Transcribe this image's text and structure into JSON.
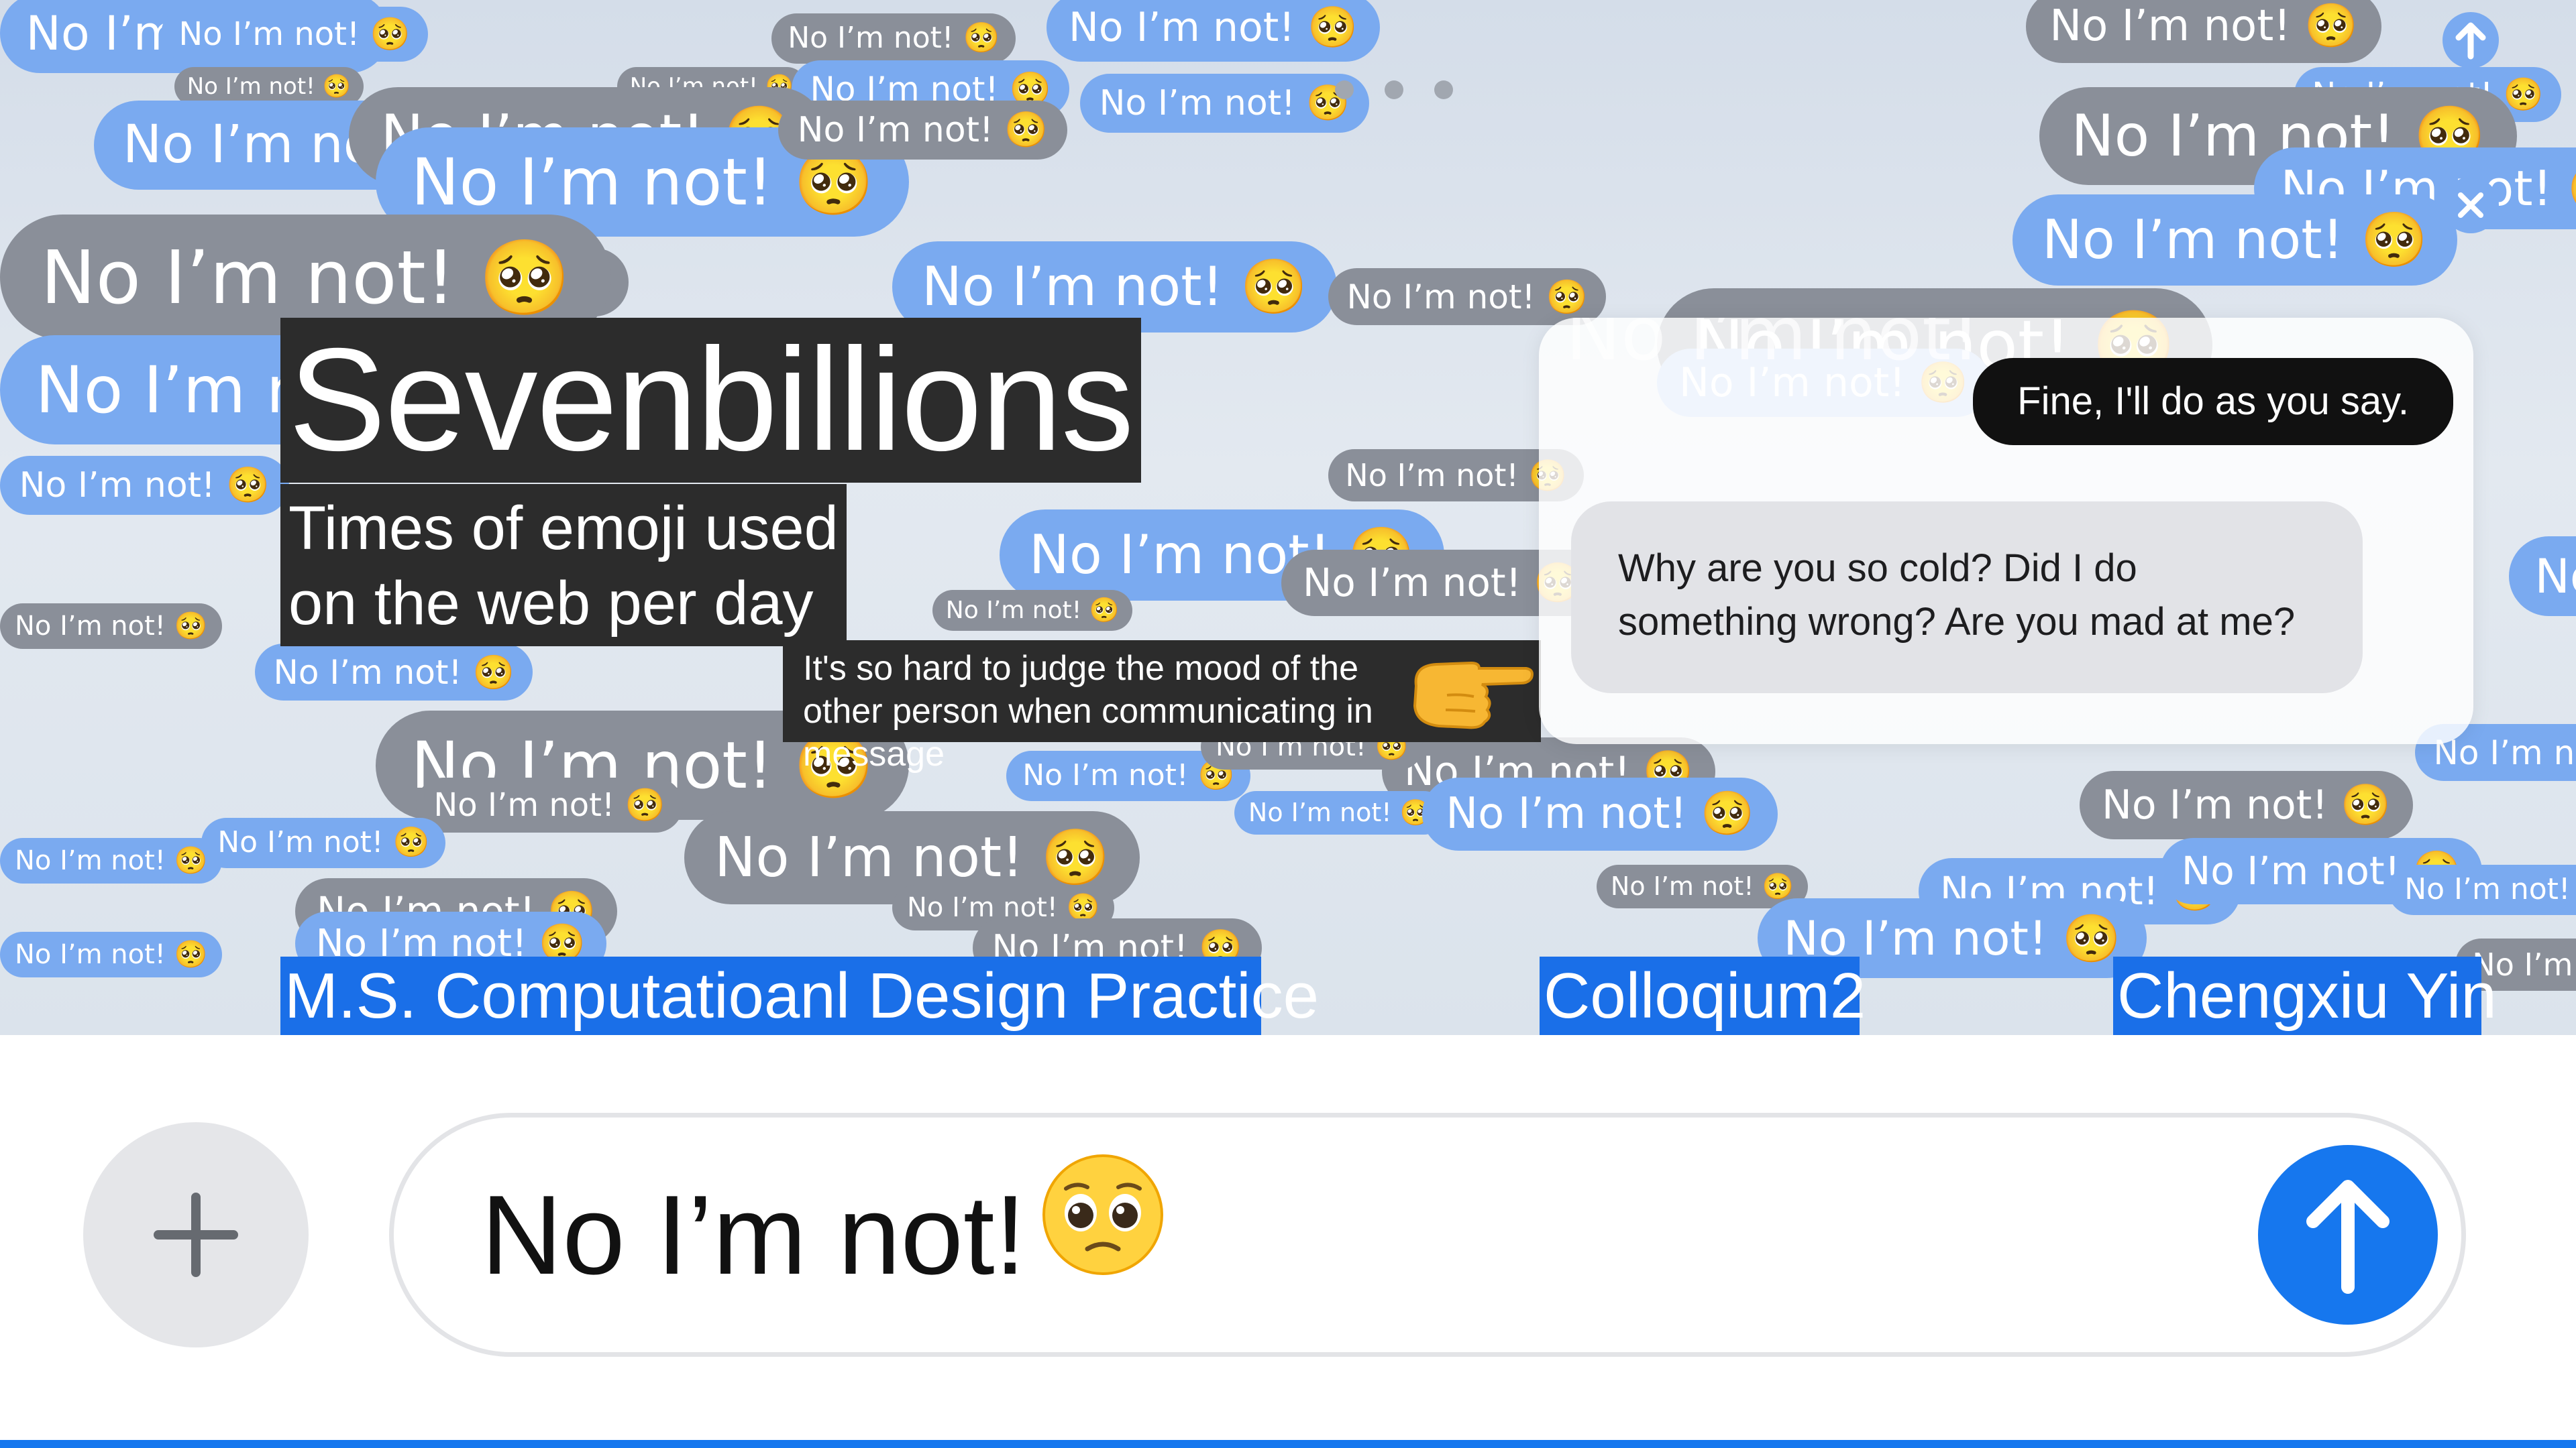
{
  "title": "Sevenbillions",
  "subtitle_line1": "Times of emoji used",
  "subtitle_line2": "on the web per day",
  "note": "It's so hard to judge the mood of the other person when communicating in message",
  "labels": {
    "program": "M.S. Computatioanl Design Practice",
    "colloquium": "Colloqium2",
    "name": "Chengxiu Yin"
  },
  "chat": {
    "sent": "Fine, I'll do as you say.",
    "received": "Why are you so cold? Did I do something wrong? Are you mad at me?",
    "ghost": "No I’m not!"
  },
  "composer": {
    "input_value": "No I’m not!",
    "input_emoji": "pleading-face-emoji"
  },
  "bubble_text": "No I’m not!",
  "colors": {
    "bubble_blue": "#7aaaf0",
    "bubble_gray": "#8a8f99",
    "title_bg": "#2c2c2c",
    "label_bg": "#1a6fe8",
    "send_blue": "#1677ee"
  },
  "icons": {
    "plus": "plus-icon",
    "send": "arrow-up-icon",
    "pointing": "pointing-right-hand-emoji",
    "close": "close-icon"
  }
}
